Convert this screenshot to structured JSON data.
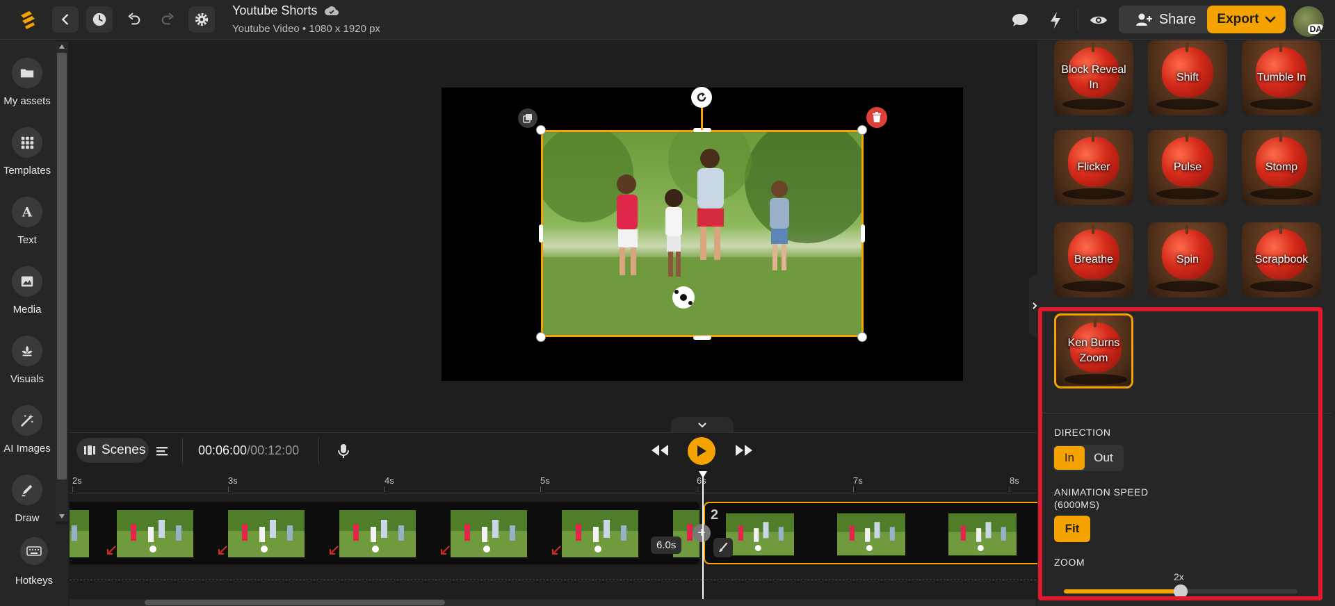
{
  "header": {
    "title": "Youtube Shorts",
    "subtitle": "Youtube Video • 1080 x 1920 px",
    "share_label": "Share",
    "export_label": "Export",
    "avatar_initials": "DA"
  },
  "sidebar": {
    "items": [
      {
        "label": "My assets",
        "icon": "folder-icon"
      },
      {
        "label": "Templates",
        "icon": "grid-icon"
      },
      {
        "label": "Text",
        "icon": "text-icon"
      },
      {
        "label": "Media",
        "icon": "image-icon"
      },
      {
        "label": "Visuals",
        "icon": "flower-icon"
      },
      {
        "label": "AI Images",
        "icon": "magic-wand-icon"
      },
      {
        "label": "Draw",
        "icon": "pen-icon"
      }
    ],
    "hotkeys_label": "Hotkeys"
  },
  "playback": {
    "scenes_label": "Scenes",
    "current_time": "00:06:00",
    "total_time": "/00:12:00"
  },
  "timeline": {
    "ticks": [
      "2s",
      "3s",
      "4s",
      "5s",
      "6s",
      "7s",
      "8s"
    ],
    "scene1_duration": "6.0s",
    "scene2_number": "2"
  },
  "animations": {
    "tiles": [
      {
        "label": "Block Reveal In"
      },
      {
        "label": "Shift"
      },
      {
        "label": "Tumble In"
      },
      {
        "label": "Flicker"
      },
      {
        "label": "Pulse"
      },
      {
        "label": "Stomp"
      },
      {
        "label": "Breathe"
      },
      {
        "label": "Spin"
      },
      {
        "label": "Scrapbook"
      },
      {
        "label": "Ken Burns Zoom"
      }
    ],
    "selected": "Ken Burns Zoom",
    "direction_label": "DIRECTION",
    "direction_in": "In",
    "direction_out": "Out",
    "speed_label_line1": "ANIMATION SPEED",
    "speed_label_line2": "(6000MS)",
    "fit_label": "Fit",
    "zoom_label": "ZOOM",
    "zoom_value": "2x",
    "zoom_fraction": 0.5
  },
  "colors": {
    "accent": "#f5a300",
    "highlight": "#e0192d",
    "delete": "#e0403a"
  }
}
